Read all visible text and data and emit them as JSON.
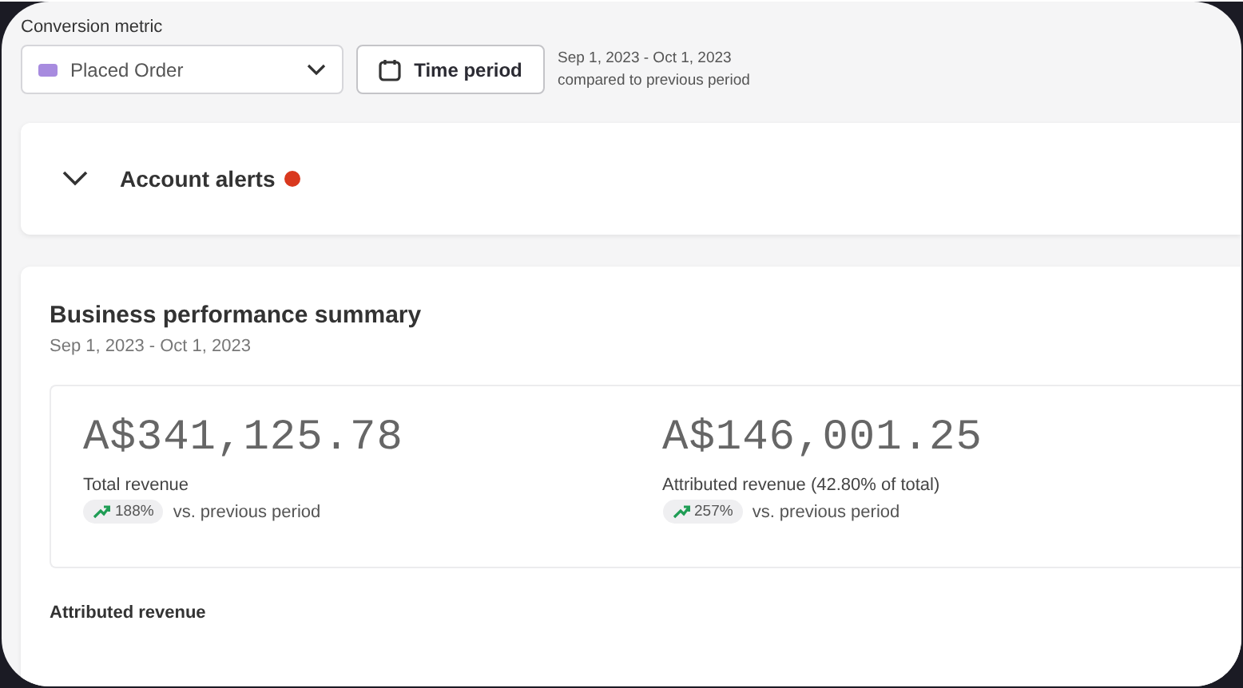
{
  "conversion_metric": {
    "label": "Conversion metric",
    "value": "Placed Order"
  },
  "time_period": {
    "button": "Time period",
    "range": "Sep 1, 2023 - Oct 1, 2023",
    "comparison": "compared to previous period"
  },
  "account_alerts": {
    "title": "Account alerts",
    "expanded": false,
    "alert": true
  },
  "summary": {
    "title": "Business performance summary",
    "date_range": "Sep 1, 2023 - Oct 1, 2023",
    "metrics": [
      {
        "value": "A$341,125.78",
        "label": "Total revenue",
        "change": "188%",
        "comparison": "vs. previous period"
      },
      {
        "value": "A$146,001.25",
        "label": "Attributed revenue (42.80% of total)",
        "change": "257%",
        "comparison": "vs. previous period"
      }
    ],
    "section_title": "Attributed revenue"
  }
}
